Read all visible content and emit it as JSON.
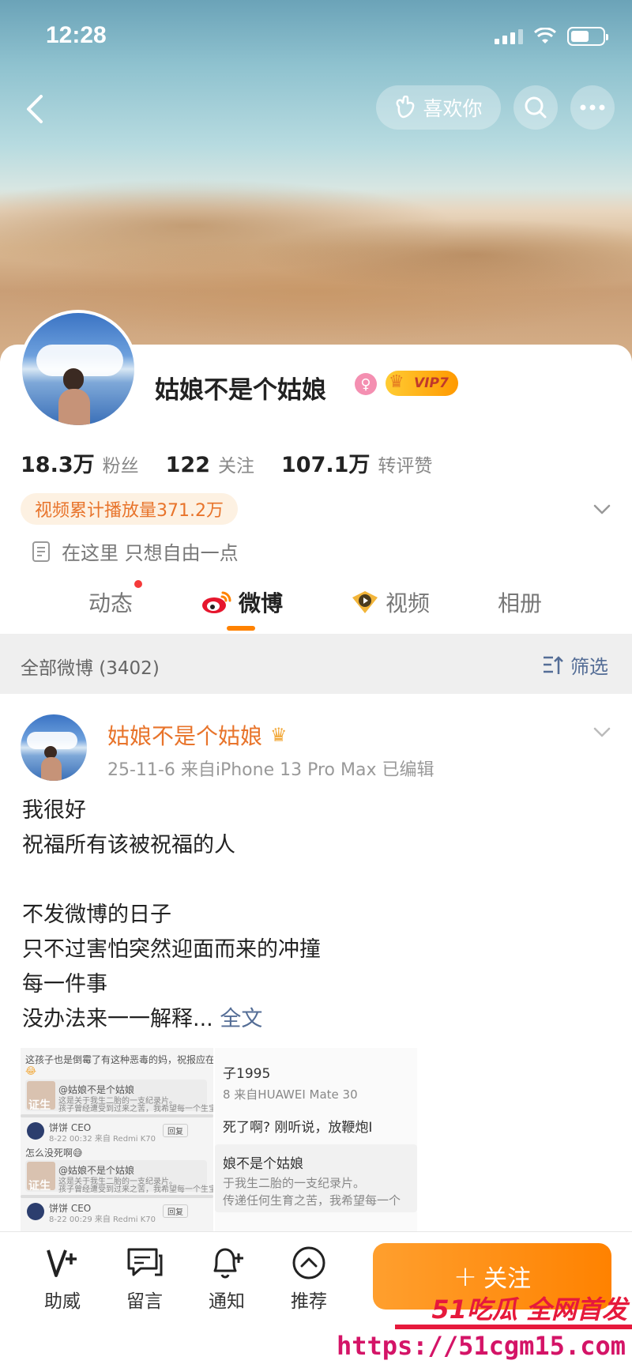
{
  "status": {
    "time": "12:28"
  },
  "header": {
    "like_label": "喜欢你"
  },
  "profile": {
    "name": "姑娘不是个姑娘",
    "vip": "VIP7",
    "stats": [
      {
        "value": "18.3万",
        "label": "粉丝"
      },
      {
        "value": "122",
        "label": "关注"
      },
      {
        "value": "107.1万",
        "label": "转评赞"
      }
    ],
    "play_count": "视频累计播放量371.2万",
    "bio": "在这里 只想自由一点"
  },
  "tabs": [
    {
      "label": "动态"
    },
    {
      "label": "微博"
    },
    {
      "label": "视频"
    },
    {
      "label": "相册"
    }
  ],
  "filter": {
    "all_label": "全部微博 (3402)",
    "filter_label": "筛选"
  },
  "post": {
    "author": "姑娘不是个姑娘",
    "meta": "25-11-6  来自iPhone 13 Pro Max  已编辑",
    "lines": [
      "我很好",
      "祝福所有该被祝福的人",
      "",
      "不发微博的日子",
      "只不过害怕突然迎面而来的冲撞",
      "每一件事",
      "没办法来一一解释..."
    ],
    "more": "全文",
    "thumb_left": {
      "t1": "这孩子也是倒霉了有这种恶毒的妈，祝报应在他身上",
      "q1": "@姑娘不是个姑娘",
      "q1b": "这是关于我生二胎的一支纪录片。",
      "q1c": "孩子曾经遭受到过来之苦，我希望每一个生宝宝可以平",
      "badge": "证生",
      "user1": "饼饼 CEO",
      "time1": "8-22 00:32 来自 Redmi K70",
      "btn": "回复",
      "t2": "怎么没死啊😅",
      "q2": "@姑娘不是个姑娘",
      "q2b": "这是关于我生二胎的一支纪录片。",
      "q2c": "孩子曾经遭受到过来之苦，我希望每一个生宝宝可以平",
      "user2": "饼饼 CEO",
      "time2": "8-22 00:29 来自 Redmi K70"
    },
    "thumb_right": {
      "r1": "子1995",
      "r2": "8  来自HUAWEI Mate 30",
      "r3": "死了啊? 刚听说，放鞭炮I",
      "r4": "娘不是个姑娘",
      "r5": "于我生二胎的一支纪录片。",
      "r6": "传递任何生育之苦，我希望每一个"
    }
  },
  "bottom": {
    "items": [
      {
        "label": "助威"
      },
      {
        "label": "留言"
      },
      {
        "label": "通知"
      },
      {
        "label": "推荐"
      }
    ],
    "follow": "关注"
  },
  "watermark": {
    "top": "51吃瓜 全网首发",
    "url": "https://51cgm15.com"
  },
  "colors": {
    "accent": "#ff8200",
    "link": "#546d96",
    "author": "#e8742b"
  }
}
